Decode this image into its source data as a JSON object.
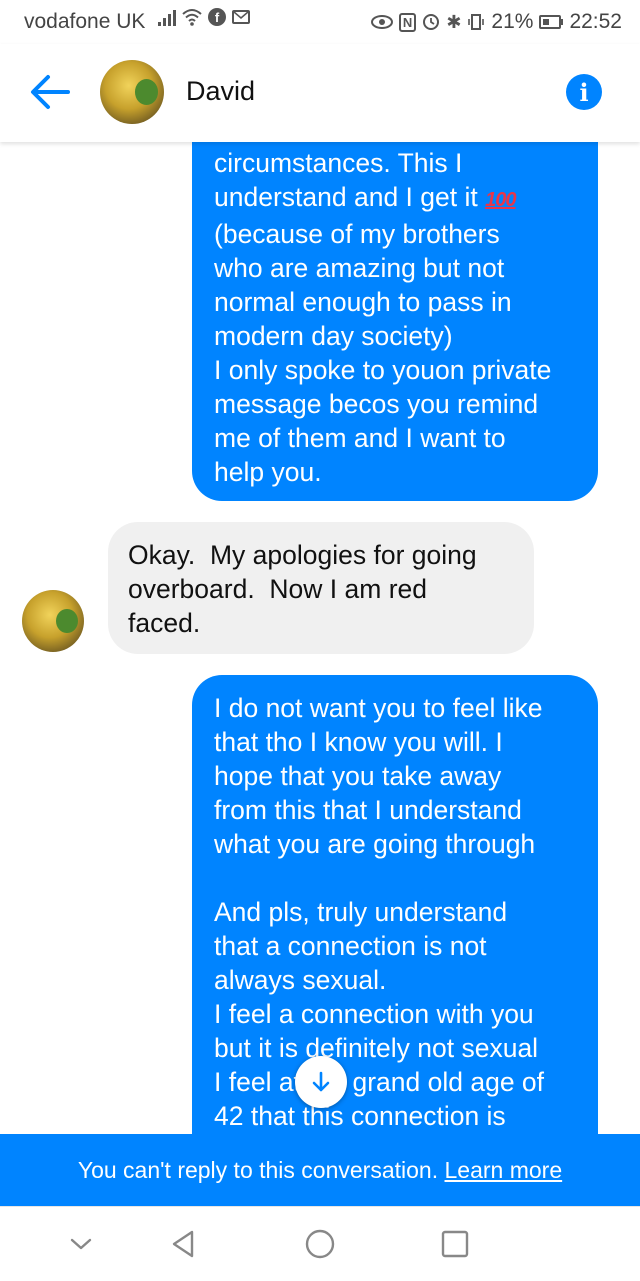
{
  "status_bar": {
    "carrier": "vodafone UK",
    "battery": "21%",
    "time": "22:52",
    "icons": [
      "signal-icon",
      "wifi-icon",
      "facebook-icon",
      "gmail-icon",
      "eye-icon",
      "nfc-icon",
      "alarm-icon",
      "bluetooth-icon",
      "vibrate-icon",
      "battery-icon"
    ]
  },
  "header": {
    "contact_name": "David",
    "back_icon": "back-arrow-icon",
    "info_icon": "info-icon"
  },
  "messages": [
    {
      "direction": "outgoing",
      "text": "circumstances. This I\nunderstand and I get it ",
      "emoji": "💯",
      "text_after": "\n(because of my brothers\nwho are amazing but not\nnormal enough to pass in\nmodern day society)\nI only spoke to youon private\nmessage becos you remind\nme of them and I want to\nhelp you."
    },
    {
      "direction": "incoming",
      "text": "Okay.  My apologies for going\noverboard.  Now I am red\nfaced."
    },
    {
      "direction": "outgoing",
      "text": "I do not want you to feel like\nthat tho I know you will. I\nhope that you take away\nfrom this that I understand\nwhat you are going through\n\nAnd pls, truly understand\nthat a connection is not\nalways sexual.\nI feel a connection with you\nbut it is definitely not sexual\nI feel at the grand old age of\n42 that this connection is"
    }
  ],
  "banner": {
    "text": "You can't reply to this conversation. ",
    "link": "Learn more"
  },
  "colors": {
    "accent": "#0084ff",
    "incoming_bubble": "#f0f0f0"
  }
}
